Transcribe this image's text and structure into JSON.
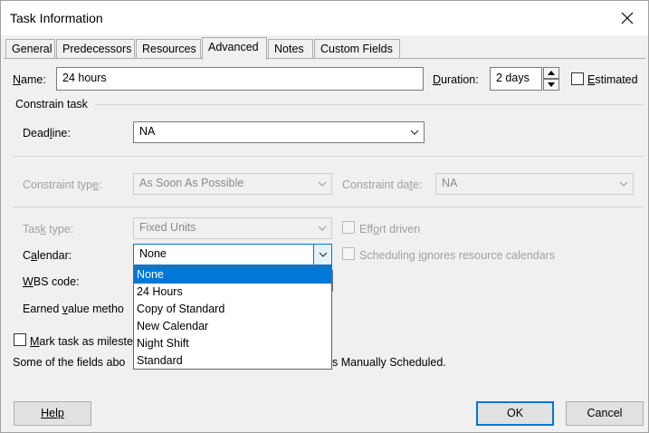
{
  "window": {
    "title": "Task Information"
  },
  "tabs": [
    {
      "label": "General"
    },
    {
      "label": "Predecessors"
    },
    {
      "label": "Resources"
    },
    {
      "label": "Advanced"
    },
    {
      "label": "Notes"
    },
    {
      "label": "Custom Fields"
    }
  ],
  "form": {
    "name_label_u": "N",
    "name_label_rest": "ame:",
    "name_value": "24 hours",
    "duration_label_u": "D",
    "duration_label_rest": "uration:",
    "duration_value": "2 days",
    "estimated_label_u": "E",
    "estimated_label_rest": "stimated",
    "constrain_task_heading": "Constrain task",
    "deadline_label_pre": "Dead",
    "deadline_label_u": "l",
    "deadline_label_post": "ine:",
    "deadline_value": "NA",
    "constraint_type_label_pre": "Constraint typ",
    "constraint_type_label_u": "e",
    "constraint_type_label_post": ":",
    "constraint_type_value": "As Soon As Possible",
    "constraint_date_label_pre": "Constraint da",
    "constraint_date_label_u": "t",
    "constraint_date_label_post": "e:",
    "constraint_date_value": "NA",
    "task_type_label_pre": "Tas",
    "task_type_label_u": "k",
    "task_type_label_post": " type:",
    "task_type_value": "Fixed Units",
    "effort_driven_label_pre": "Eff",
    "effort_driven_label_u": "o",
    "effort_driven_label_post": "rt driven",
    "calendar_label_pre": "C",
    "calendar_label_u": "a",
    "calendar_label_post": "lendar:",
    "calendar_value": "None",
    "sched_ignores_label_pre": "Scheduling ",
    "sched_ignores_label_u": "i",
    "sched_ignores_label_post": "gnores resource calendars",
    "wbs_label_u": "W",
    "wbs_label_rest": "BS code:",
    "earned_value_label_pre": "Earned ",
    "earned_value_label_u": "v",
    "earned_value_label_post": "alue metho",
    "milestone_label_u": "M",
    "milestone_label_rest": "ark task as mileste",
    "note_left": "Some of the fields abo",
    "note_right": "s Manually Scheduled."
  },
  "calendar_options": [
    "None",
    "24 Hours",
    "Copy of Standard",
    "New Calendar",
    "Night Shift",
    "Standard"
  ],
  "buttons": {
    "help": "Help",
    "ok": "OK",
    "cancel": "Cancel"
  },
  "colors": {
    "accent": "#0078d7",
    "disabled_text": "#a0a0a0"
  }
}
